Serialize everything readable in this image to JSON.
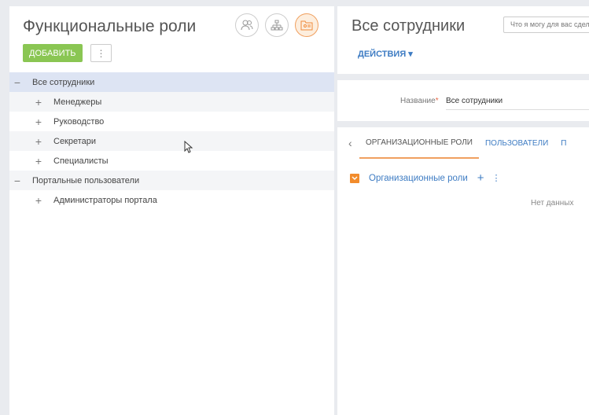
{
  "left": {
    "title": "Функциональные роли",
    "add_button": "ДОБАВИТЬ",
    "more_button": "⋮",
    "view_icons": [
      "users-icon",
      "org-structure-icon",
      "functional-roles-icon"
    ]
  },
  "tree": [
    {
      "label": "Все сотрудники",
      "sign": "−",
      "level": 0,
      "selected": true
    },
    {
      "label": "Менеджеры",
      "sign": "+",
      "level": 1
    },
    {
      "label": "Руководство",
      "sign": "+",
      "level": 1
    },
    {
      "label": "Секретари",
      "sign": "+",
      "level": 1
    },
    {
      "label": "Специалисты",
      "sign": "+",
      "level": 1
    },
    {
      "label": "Портальные пользователи",
      "sign": "−",
      "level": 0
    },
    {
      "label": "Администраторы портала",
      "sign": "+",
      "level": 1
    }
  ],
  "right": {
    "title": "Все сотрудники",
    "search_placeholder": "Что я могу для вас сделать?",
    "actions": "ДЕЙСТВИЯ ▾",
    "field_label": "Название",
    "field_required": "*",
    "field_value": "Все сотрудники",
    "tab_back": "‹",
    "tabs": [
      "ОРГАНИЗАЦИОННЫЕ РОЛИ",
      "ПОЛЬЗОВАТЕЛИ",
      "П"
    ],
    "detail_title": "Организационные роли",
    "detail_add": "+",
    "detail_more": "⋮",
    "no_data": "Нет данных"
  },
  "colors": {
    "accent_blue": "#3e7cc3",
    "add_green": "#8ac653",
    "orange": "#f28c2c",
    "selected_row": "#dde4f3"
  }
}
